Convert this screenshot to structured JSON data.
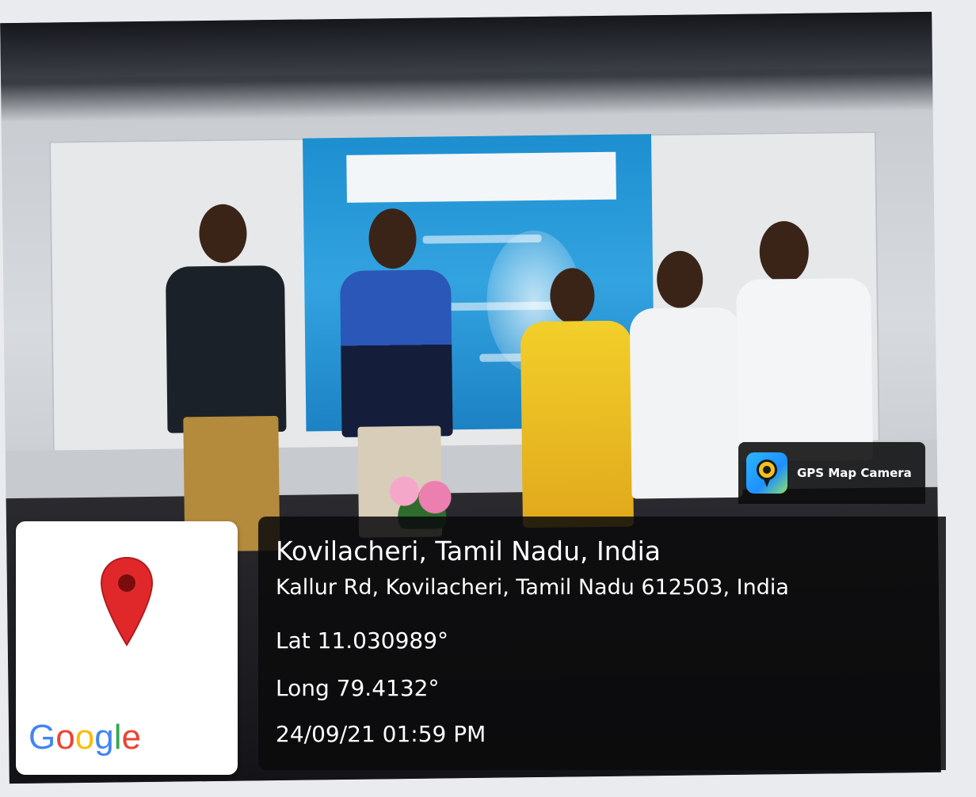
{
  "overlay": {
    "app_name": "GPS Map Camera",
    "app_icon": "gps-map-camera-icon",
    "place_title": "Kovilacheri, Tamil Nadu, India",
    "address": "Kallur Rd, Kovilacheri, Tamil Nadu 612503, India",
    "latitude": "Lat 11.030989°",
    "longitude": "Long 79.4132°",
    "datetime": "24/09/21 01:59 PM"
  },
  "map_thumbnail": {
    "icon": "map-pin-icon",
    "logo": [
      "G",
      "o",
      "o",
      "g",
      "l",
      "e"
    ],
    "pin_color": "#e0282b"
  },
  "colors": {
    "overlay_bg": "#0a0a0c",
    "overlay_text": "#ffffff",
    "google_blue": "#4285f4",
    "google_red": "#ea4335",
    "google_yellow": "#fbbc05",
    "google_green": "#34a853"
  }
}
